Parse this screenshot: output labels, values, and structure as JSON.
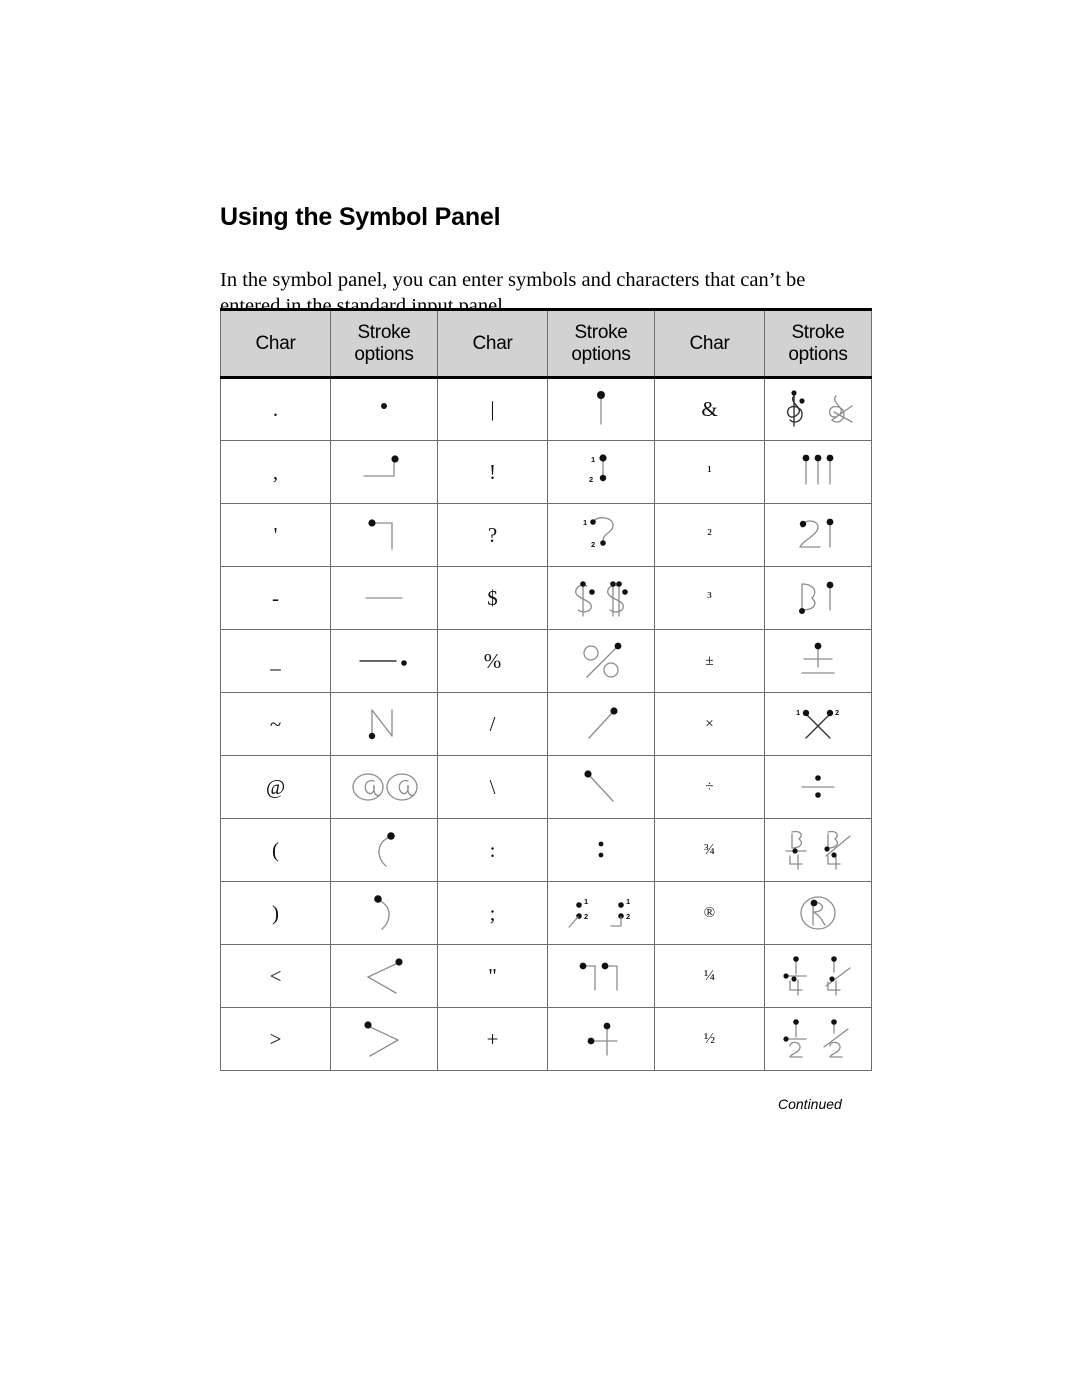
{
  "document": {
    "page_title": "Using the Symbol Panel",
    "intro_paragraph": "In the symbol panel, you can enter symbols and characters that can’t be entered in the standard input panel.",
    "footer_note": "Continued"
  },
  "table": {
    "header": {
      "char_label": "Char",
      "stroke_label_line1": "Stroke",
      "stroke_label_line2": "options",
      "background_color": "#d2d2d2",
      "border_color": "#6e6e6e",
      "column_count": 6,
      "groups": 3
    },
    "columns": [
      {
        "key": "char_1",
        "label": "Char"
      },
      {
        "key": "stroke_1",
        "label": "Stroke options"
      },
      {
        "key": "char_2",
        "label": "Char"
      },
      {
        "key": "stroke_2",
        "label": "Stroke options"
      },
      {
        "key": "char_3",
        "label": "Char"
      },
      {
        "key": "stroke_3",
        "label": "Stroke options"
      }
    ],
    "row_count": 11,
    "rows": [
      {
        "char_1": ".",
        "stroke_1_name": "period-stroke",
        "char_2": "|",
        "stroke_2_name": "vertical-bar-stroke",
        "char_3": "&",
        "stroke_3_name": "ampersand-stroke"
      },
      {
        "char_1": ",",
        "stroke_1_name": "comma-stroke",
        "char_2": "!",
        "stroke_2_name": "exclamation-stroke",
        "char_3": "¹",
        "stroke_3_name": "superscript-one-stroke"
      },
      {
        "char_1": "'",
        "stroke_1_name": "apostrophe-stroke",
        "char_2": "?",
        "stroke_2_name": "question-mark-stroke",
        "char_3": "²",
        "stroke_3_name": "superscript-two-stroke"
      },
      {
        "char_1": "-",
        "stroke_1_name": "hyphen-stroke",
        "char_2": "$",
        "stroke_2_name": "dollar-stroke",
        "char_3": "³",
        "stroke_3_name": "superscript-three-stroke"
      },
      {
        "char_1": "_",
        "stroke_1_name": "underscore-stroke",
        "char_2": "%",
        "stroke_2_name": "percent-stroke",
        "char_3": "±",
        "stroke_3_name": "plus-minus-stroke"
      },
      {
        "char_1": "~",
        "stroke_1_name": "tilde-stroke",
        "char_2": "/",
        "stroke_2_name": "forward-slash-stroke",
        "char_3": "×",
        "stroke_3_name": "multiplication-stroke"
      },
      {
        "char_1": "@",
        "stroke_1_name": "at-sign-stroke",
        "char_2": "\\",
        "stroke_2_name": "backslash-stroke",
        "char_3": "÷",
        "stroke_3_name": "division-stroke"
      },
      {
        "char_1": "(",
        "stroke_1_name": "open-paren-stroke",
        "char_2": ":",
        "stroke_2_name": "colon-stroke",
        "char_3": "¾",
        "stroke_3_name": "three-quarters-stroke"
      },
      {
        "char_1": ")",
        "stroke_1_name": "close-paren-stroke",
        "char_2": ";",
        "stroke_2_name": "semicolon-stroke",
        "char_3": "®",
        "stroke_3_name": "registered-stroke"
      },
      {
        "char_1": "<",
        "stroke_1_name": "less-than-stroke",
        "char_2": "\"",
        "stroke_2_name": "double-quote-stroke",
        "char_3": "¼",
        "stroke_3_name": "one-quarter-stroke"
      },
      {
        "char_1": ">",
        "stroke_1_name": "greater-than-stroke",
        "char_2": "+",
        "stroke_2_name": "plus-stroke",
        "char_3": "½",
        "stroke_3_name": "one-half-stroke"
      }
    ],
    "stroke_order_labels": [
      "1",
      "2"
    ]
  },
  "colors": {
    "page_background": "#ffffff",
    "text": "#000000",
    "header_fill": "#d2d2d2",
    "grid_line": "#6e6e6e",
    "heavy_rule": "#000000",
    "ink_light": "#8c8c8c",
    "ink_dark": "#333333",
    "dot": "#111111"
  }
}
